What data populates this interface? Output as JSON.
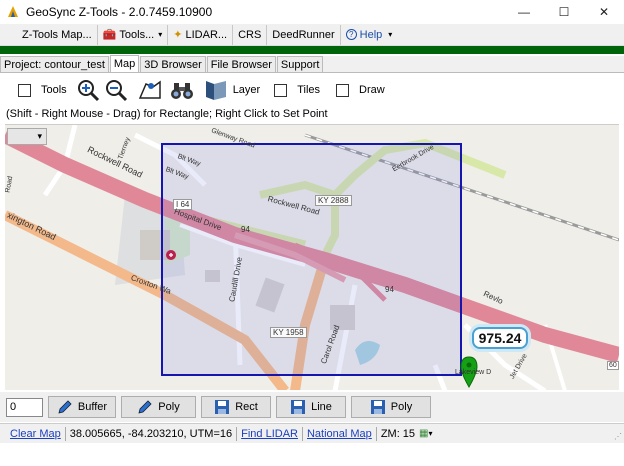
{
  "window": {
    "title": "GeoSync Z-Tools  - 2.0.7459.10900",
    "minimize": "—",
    "maximize": "☐",
    "close": "✕"
  },
  "menu": [
    {
      "label": "Z-Tools Map...",
      "icon": "gear-icon"
    },
    {
      "label": "Tools...",
      "icon": "tools-icon",
      "dropdown": true
    },
    {
      "label": "LIDAR...",
      "icon": "wand-icon"
    },
    {
      "label": "CRS"
    },
    {
      "label": "DeedRunner"
    },
    {
      "label": "Help",
      "icon": "help-icon",
      "dropdown": true
    }
  ],
  "tabs": [
    {
      "label": "Project: contour_test",
      "active": false
    },
    {
      "label": "Map",
      "active": true
    },
    {
      "label": "3D Browser",
      "active": false
    },
    {
      "label": "File Browser",
      "active": false
    },
    {
      "label": "Support",
      "active": false
    }
  ],
  "toolbar": {
    "tools_label": "Tools",
    "layer_label": "Layer",
    "tiles_label": "Tiles",
    "draw_label": "Draw"
  },
  "hint": "(Shift - Right Mouse - Drag) for Rectangle;  Right Click to Set Point",
  "map": {
    "elevation": "975.24",
    "labels": {
      "rockwell_road_1": "Rockwell Road",
      "rockwell_road_2": "Rockwell Road",
      "i64": "I 64",
      "hospital_drive": "Hospital Drive",
      "num94a": "94",
      "num94b": "94",
      "ky2888": "KY 2888",
      "ky1958": "KY 1958",
      "lexington_road": "xington Road",
      "croxton": "Croxton Wa",
      "caudill": "Caudill Drive",
      "carol": "Carol Road",
      "revlon": "Revlo",
      "glenway": "Glenway Road",
      "tierney": "Tierney",
      "blt_way": "Blt Way",
      "blt_way2": "Blt Way",
      "eerbrook": "Eerbrook Drive",
      "lakeview": "Lakeview D",
      "jet": "Jet Drive",
      "road_left": "Road",
      "num_right": "60"
    },
    "rect_color": "#1515b0",
    "interstate_color": "#e08898",
    "primary_color": "#f3b98a",
    "secondary_color": "#d8e8a8"
  },
  "bottom": {
    "input_value": "0",
    "buttons": [
      {
        "label": "Buffer",
        "icon": "pencil-icon"
      },
      {
        "label": "Poly",
        "icon": "pencil-icon"
      },
      {
        "label": "Rect",
        "icon": "save-icon"
      },
      {
        "label": "Line",
        "icon": "save-icon"
      },
      {
        "label": "Poly",
        "icon": "save-icon"
      }
    ]
  },
  "status": {
    "clear_map": "Clear Map",
    "coords": "38.005665, -84.203210, UTM=16",
    "find_lidar": "Find LIDAR",
    "national_map": "National Map",
    "zoom": "ZM: 15"
  }
}
